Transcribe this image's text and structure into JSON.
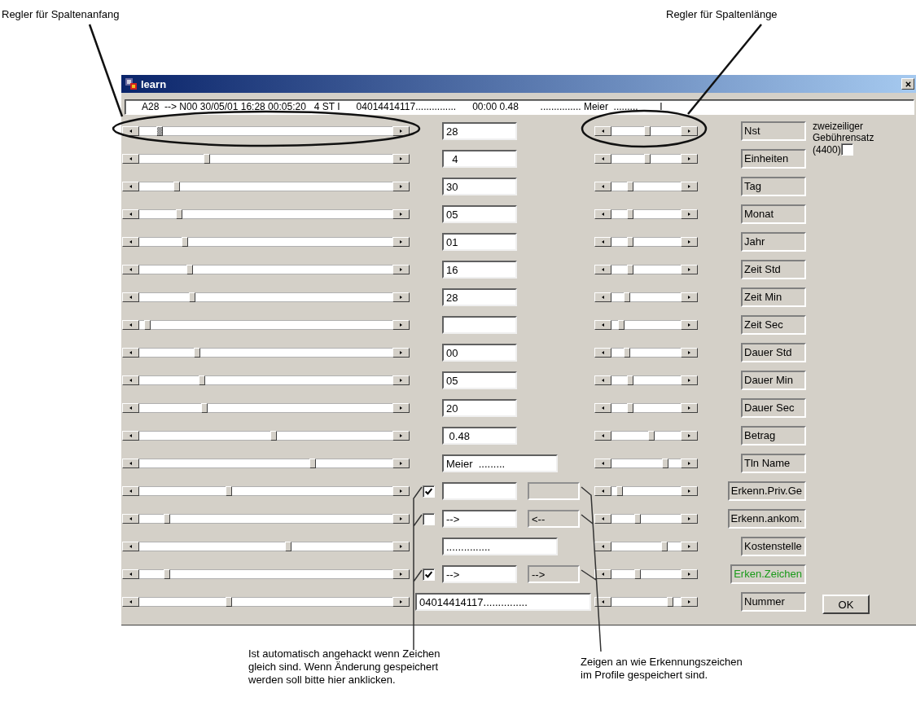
{
  "annotations": {
    "top_left": "Regler für Spaltenanfang",
    "top_right": "Regler für Spaltenlänge",
    "bottom_left": [
      "Ist automatisch angehackt wenn Zeichen",
      "gleich sind. Wenn Änderung gespeichert",
      "werden soll bitte hier anklicken."
    ],
    "bottom_right": [
      "Zeigen an wie Erkennungszeichen",
      "im Profile gespeichert sind."
    ]
  },
  "window": {
    "title": "learn",
    "record": "A28  --> N00 30/05/01 16:28 00:05:20   4 ST I      04014414117...............      00:00 0.48        ............... Meier  .........        I"
  },
  "rows": [
    {
      "kind": "field",
      "start": {
        "level": 0.07,
        "focused": true
      },
      "value": "28",
      "length": {
        "level": 0.52
      },
      "label": "Nst",
      "highlighted": false
    },
    {
      "kind": "field",
      "start": {
        "level": 0.26,
        "focused": false
      },
      "value": "  4",
      "length": {
        "level": 0.52
      },
      "label": "Einheiten",
      "highlighted": false
    },
    {
      "kind": "field",
      "start": {
        "level": 0.14,
        "focused": false
      },
      "value": "30",
      "length": {
        "level": 0.25
      },
      "label": "Tag",
      "highlighted": false
    },
    {
      "kind": "field",
      "start": {
        "level": 0.15,
        "focused": false
      },
      "value": "05",
      "length": {
        "level": 0.25
      },
      "label": "Monat",
      "highlighted": false
    },
    {
      "kind": "field",
      "start": {
        "level": 0.17,
        "focused": false
      },
      "value": "01",
      "length": {
        "level": 0.25
      },
      "label": "Jahr",
      "highlighted": false
    },
    {
      "kind": "field",
      "start": {
        "level": 0.19,
        "focused": false
      },
      "value": "16",
      "length": {
        "level": 0.25
      },
      "label": "Zeit Std",
      "highlighted": false
    },
    {
      "kind": "field",
      "start": {
        "level": 0.2,
        "focused": false
      },
      "value": "28",
      "length": {
        "level": 0.19
      },
      "label": "Zeit Min",
      "highlighted": false
    },
    {
      "kind": "field",
      "start": {
        "level": 0.02,
        "focused": false
      },
      "length": {
        "level": 0.1
      },
      "label": "Zeit Sec",
      "highlighted": false
    },
    {
      "kind": "field",
      "start": {
        "level": 0.22,
        "focused": false
      },
      "value": "00",
      "length": {
        "level": 0.19
      },
      "label": "Dauer Std",
      "highlighted": false
    },
    {
      "kind": "field",
      "start": {
        "level": 0.24,
        "focused": false
      },
      "value": "05",
      "length": {
        "level": 0.25
      },
      "label": "Dauer Min",
      "highlighted": false
    },
    {
      "kind": "field",
      "start": {
        "level": 0.25,
        "focused": false
      },
      "value": "20",
      "length": {
        "level": 0.25
      },
      "label": "Dauer Sec",
      "highlighted": false
    },
    {
      "kind": "field",
      "start": {
        "level": 0.53,
        "focused": false
      },
      "value": " 0.48",
      "length": {
        "level": 0.59
      },
      "label": "Betrag",
      "highlighted": false
    },
    {
      "kind": "long",
      "start": {
        "level": 0.69,
        "focused": false
      },
      "value": "Meier  .........",
      "length": {
        "level": 0.81
      },
      "label": "Tln Name",
      "highlighted": false
    },
    {
      "kind": "compare",
      "start": {
        "level": 0.35,
        "focused": false
      },
      "checked": true,
      "length": {
        "level": 0.08
      },
      "label": "Erkenn.Priv.Ge",
      "highlighted": false
    },
    {
      "kind": "compare",
      "start": {
        "level": 0.1,
        "focused": false
      },
      "checked": false,
      "value": "-->",
      "stored": "<--",
      "length": {
        "level": 0.37
      },
      "label": "Erkenn.ankom.",
      "highlighted": false
    },
    {
      "kind": "long",
      "start": {
        "level": 0.59,
        "focused": false
      },
      "value": "...............",
      "length": {
        "level": 0.79
      },
      "label": "Kostenstelle",
      "highlighted": false
    },
    {
      "kind": "compare",
      "start": {
        "level": 0.1,
        "focused": false
      },
      "checked": true,
      "value": "-->",
      "stored": "-->",
      "length": {
        "level": 0.37
      },
      "label": "Erken.Zeichen",
      "highlighted": true
    },
    {
      "kind": "number",
      "start": {
        "level": 0.35,
        "focused": false
      },
      "value": "04014414117...............",
      "length": {
        "level": 0.88
      },
      "label": "Nummer",
      "highlighted": false
    }
  ],
  "option": {
    "lines": [
      "zweizeiliger",
      "Gebührensatz",
      "(4400)"
    ],
    "checked": false
  },
  "ok_button": "OK"
}
